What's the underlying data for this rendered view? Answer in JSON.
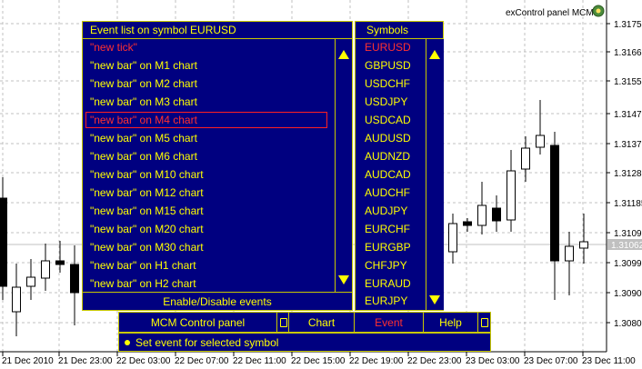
{
  "chart_title": "exControl panel MCM",
  "price_axis": {
    "labels": [
      "1.31750",
      "1.31660",
      "1.31555",
      "1.31470",
      "1.31375",
      "1.31280",
      "1.31185",
      "1.31090",
      "1.30995",
      "1.30900",
      "1.30805"
    ],
    "current_price": "1.31062"
  },
  "time_axis": {
    "labels": [
      "21 Dec 2010",
      "21 Dec 23:00",
      "22 Dec 03:00",
      "22 Dec 07:00",
      "22 Dec 11:00",
      "22 Dec 15:00",
      "22 Dec 19:00",
      "22 Dec 23:00",
      "23 Dec 03:00",
      "23 Dec 07:00",
      "23 Dec 11:00"
    ]
  },
  "event_panel": {
    "title": "Event list on symbol EURUSD",
    "items": [
      "\"new tick\"",
      "\"new bar\" on M1 chart",
      "\"new bar\" on M2 chart",
      "\"new bar\" on M3 chart",
      "\"new bar\" on M4 chart",
      "\"new bar\" on M5 chart",
      "\"new bar\" on M6 chart",
      "\"new bar\" on M10 chart",
      "\"new bar\" on M12 chart",
      "\"new bar\" on M15 chart",
      "\"new bar\" on M20 chart",
      "\"new bar\" on M30 chart",
      "\"new bar\" on H1 chart",
      "\"new bar\" on H2 chart"
    ],
    "footer": "Enable/Disable events"
  },
  "symbols_panel": {
    "title": "Symbols",
    "items": [
      "EURUSD",
      "GBPUSD",
      "USDCHF",
      "USDJPY",
      "USDCAD",
      "AUDUSD",
      "AUDNZD",
      "AUDCAD",
      "AUDCHF",
      "AUDJPY",
      "EURCHF",
      "EURGBP",
      "CHFJPY",
      "EURAUD",
      "EURJPY"
    ]
  },
  "menu_bar": {
    "control_panel": "MCM Control panel",
    "chart": "Chart",
    "event": "Event",
    "help": "Help"
  },
  "status_bar": {
    "text": "Set event for selected symbol"
  },
  "colors": {
    "panel_bg": "#000080",
    "panel_border": "#c8c800",
    "text": "#ffff00",
    "active_text": "#ff3030"
  }
}
